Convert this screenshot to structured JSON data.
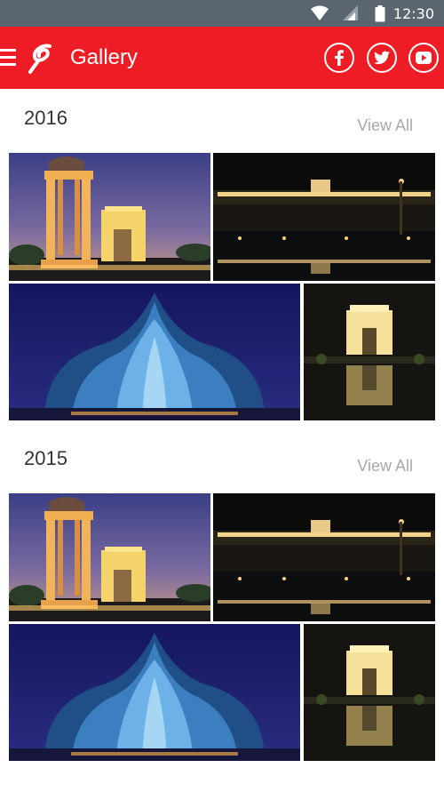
{
  "status_bar": {
    "time": "12:30",
    "icons": [
      "wifi-icon",
      "signal-icon",
      "battery-icon"
    ]
  },
  "app_bar": {
    "title": "Gallery",
    "menu_icon": "hamburger-menu-icon",
    "logo": "airtel-logo",
    "social": [
      "facebook-icon",
      "twitter-icon",
      "youtube-icon"
    ],
    "background_color": "#ee1c25"
  },
  "sections": [
    {
      "year": "2016",
      "view_all": "View All",
      "photos": [
        "canopy-and-india-gate-dusk",
        "rashtrapati-bhavan-night-reflection",
        "lotus-temple-blue-night",
        "india-gate-illuminated-night"
      ]
    },
    {
      "year": "2015",
      "view_all": "View All",
      "photos": [
        "canopy-and-india-gate-dusk",
        "rashtrapati-bhavan-night-reflection",
        "lotus-temple-blue-night",
        "india-gate-illuminated-night"
      ]
    }
  ]
}
